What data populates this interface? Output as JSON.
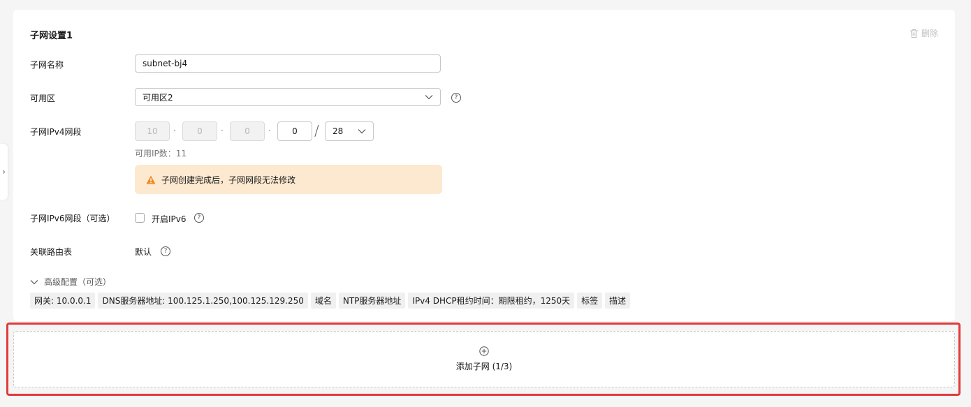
{
  "section": {
    "title": "子网设置1",
    "delete_label": "删除"
  },
  "fields": {
    "subnet_name": {
      "label": "子网名称",
      "value": "subnet-bj4"
    },
    "az": {
      "label": "可用区",
      "value": "可用区2"
    },
    "ipv4": {
      "label": "子网IPv4网段",
      "octets": [
        "10",
        "0",
        "0",
        "0"
      ],
      "mask": "28",
      "available_label": "可用IP数：11",
      "warning": "子网创建完成后，子网网段无法修改"
    },
    "ipv6": {
      "label": "子网IPv6网段（可选）",
      "checkbox_label": "开启IPv6",
      "checked": false
    },
    "route_table": {
      "label": "关联路由表",
      "value": "默认"
    }
  },
  "advanced": {
    "label": "高级配置（可选）",
    "tags": [
      "网关: 10.0.0.1",
      "DNS服务器地址: 100.125.1.250,100.125.129.250",
      "域名",
      "NTP服务器地址",
      "IPv4 DHCP租约时间：期限租约，1250天",
      "标签",
      "描述"
    ]
  },
  "add_subnet": {
    "label": "添加子网 (1/3)"
  },
  "colors": {
    "highlight": "#e03a3a",
    "warning_bg": "#fde9d0",
    "warning_icon": "#f08a24"
  }
}
